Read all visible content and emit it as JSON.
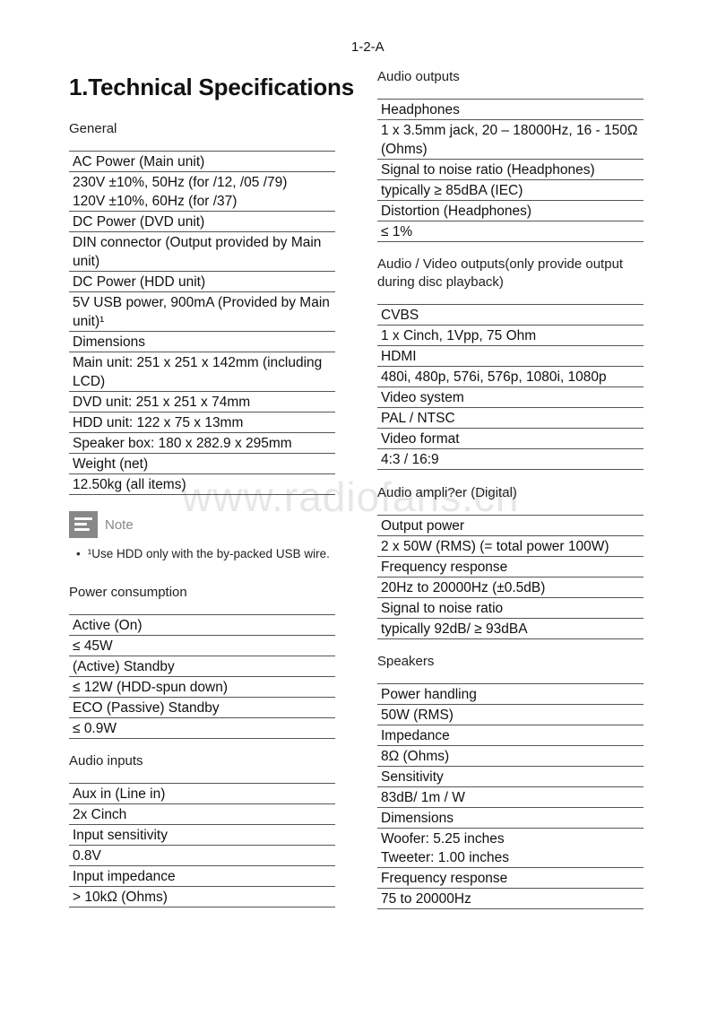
{
  "page_number": "1-2-A",
  "title": "1.Technical Specifications",
  "watermark": "www.radiofans.cn",
  "left_column": {
    "general": {
      "heading": "General",
      "rows": [
        "AC Power (Main unit)",
        "230V ±10%, 50Hz (for /12, /05 /79)\n120V ±10%, 60Hz (for /37)",
        "DC Power (DVD unit)",
        "DIN connector (Output provided by Main unit)",
        "DC Power (HDD unit)",
        "5V USB power, 900mA (Provided by Main unit)¹",
        "Dimensions",
        "Main unit: 251 x 251 x 142mm (including LCD)",
        "DVD unit: 251 x 251 x 74mm",
        "HDD unit: 122 x 75 x 13mm",
        "Speaker box: 180 x 282.9 x 295mm",
        "Weight (net)",
        "12.50kg (all items)"
      ]
    },
    "note": {
      "icon": "note-icon",
      "label": "Note",
      "bullet": "•",
      "text": "¹Use HDD only with the by-packed USB wire."
    },
    "power_consumption": {
      "heading": "Power consumption",
      "rows": [
        "Active (On)",
        " ≤ 45W",
        "(Active) Standby",
        "≤ 12W (HDD-spun down)",
        "ECO (Passive) Standby",
        "≤ 0.9W"
      ]
    },
    "audio_inputs": {
      "heading": "Audio inputs",
      "rows": [
        "Aux in (Line in)",
        "2x Cinch",
        "Input sensitivity",
        "0.8V",
        "Input impedance",
        "> 10kΩ (Ohms)"
      ]
    }
  },
  "right_column": {
    "audio_outputs": {
      "heading": "Audio outputs",
      "rows": [
        "Headphones",
        "1 x 3.5mm jack, 20 – 18000Hz, 16 - 150Ω (Ohms)",
        "Signal to noise ratio (Headphones)",
        "typically ≥ 85dBA (IEC)",
        "Distortion (Headphones)",
        "≤ 1%"
      ]
    },
    "av_outputs": {
      "heading": "Audio / Video outputs(only provide output during disc playback)",
      "rows": [
        "CVBS",
        "1 x Cinch, 1Vpp, 75 Ohm",
        "HDMI",
        "480i, 480p, 576i, 576p, 1080i, 1080p",
        "Video system",
        "PAL / NTSC",
        "Video format",
        "4:3 / 16:9"
      ]
    },
    "amplifier": {
      "heading": "Audio ampli?er (Digital)",
      "rows": [
        "Output power",
        "2 x 50W (RMS) (= total power 100W)",
        "Frequency response",
        "20Hz to 20000Hz (±0.5dB)",
        "Signal to noise ratio",
        "typically 92dB/ ≥ 93dBA"
      ]
    },
    "speakers": {
      "heading": "Speakers",
      "rows": [
        "Power handling",
        "50W (RMS)",
        "Impedance",
        "8Ω (Ohms)",
        "Sensitivity",
        "83dB/ 1m / W",
        "Dimensions",
        "Woofer: 5.25 inches\nTweeter: 1.00 inches",
        "Frequency response",
        "75 to 20000Hz"
      ]
    }
  }
}
